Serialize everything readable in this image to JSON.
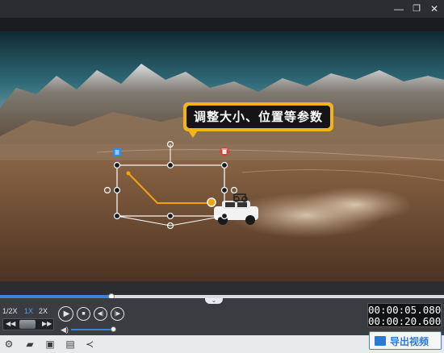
{
  "window": {
    "minimize_icon": "minimize-icon",
    "restore_icon": "restore-icon",
    "close_icon": "close-icon",
    "minimize_glyph": "—",
    "restore_glyph": "❐",
    "close_glyph": "✕"
  },
  "overlay": {
    "callout_text": "调整大小、位置等参数",
    "callout_color": "#f2b517",
    "selection_list_icon": "list-icon",
    "selection_delete_icon": "trash-icon",
    "list_icon_color": "#2f8bea",
    "delete_icon_color": "#e53935",
    "pointer_color": "#f2a20c"
  },
  "playback": {
    "progress_fraction": 0.25,
    "speeds": [
      "1/2X",
      "1X",
      "2X"
    ],
    "active_speed": "1X",
    "jog_back_glyph": "◀◀",
    "jog_forward_glyph": "▶▶",
    "play_glyph": "▶",
    "stop_glyph": "■",
    "prev_glyph": "◀|",
    "next_glyph": "|▶",
    "volume_glyph": "◀)",
    "volume_fraction": 1.0,
    "current_time": "00:00:05.080",
    "total_time": "00:00:20.600",
    "collapse_glyph": "⌄",
    "accent_color": "#3b82d8"
  },
  "toolbar": {
    "icons": [
      "settings-icon",
      "folder-icon",
      "save-icon",
      "save-as-icon",
      "share-icon"
    ],
    "glyphs": [
      "⚙",
      "▰",
      "▣",
      "▤",
      "≺"
    ],
    "export_label": "导出视频"
  }
}
